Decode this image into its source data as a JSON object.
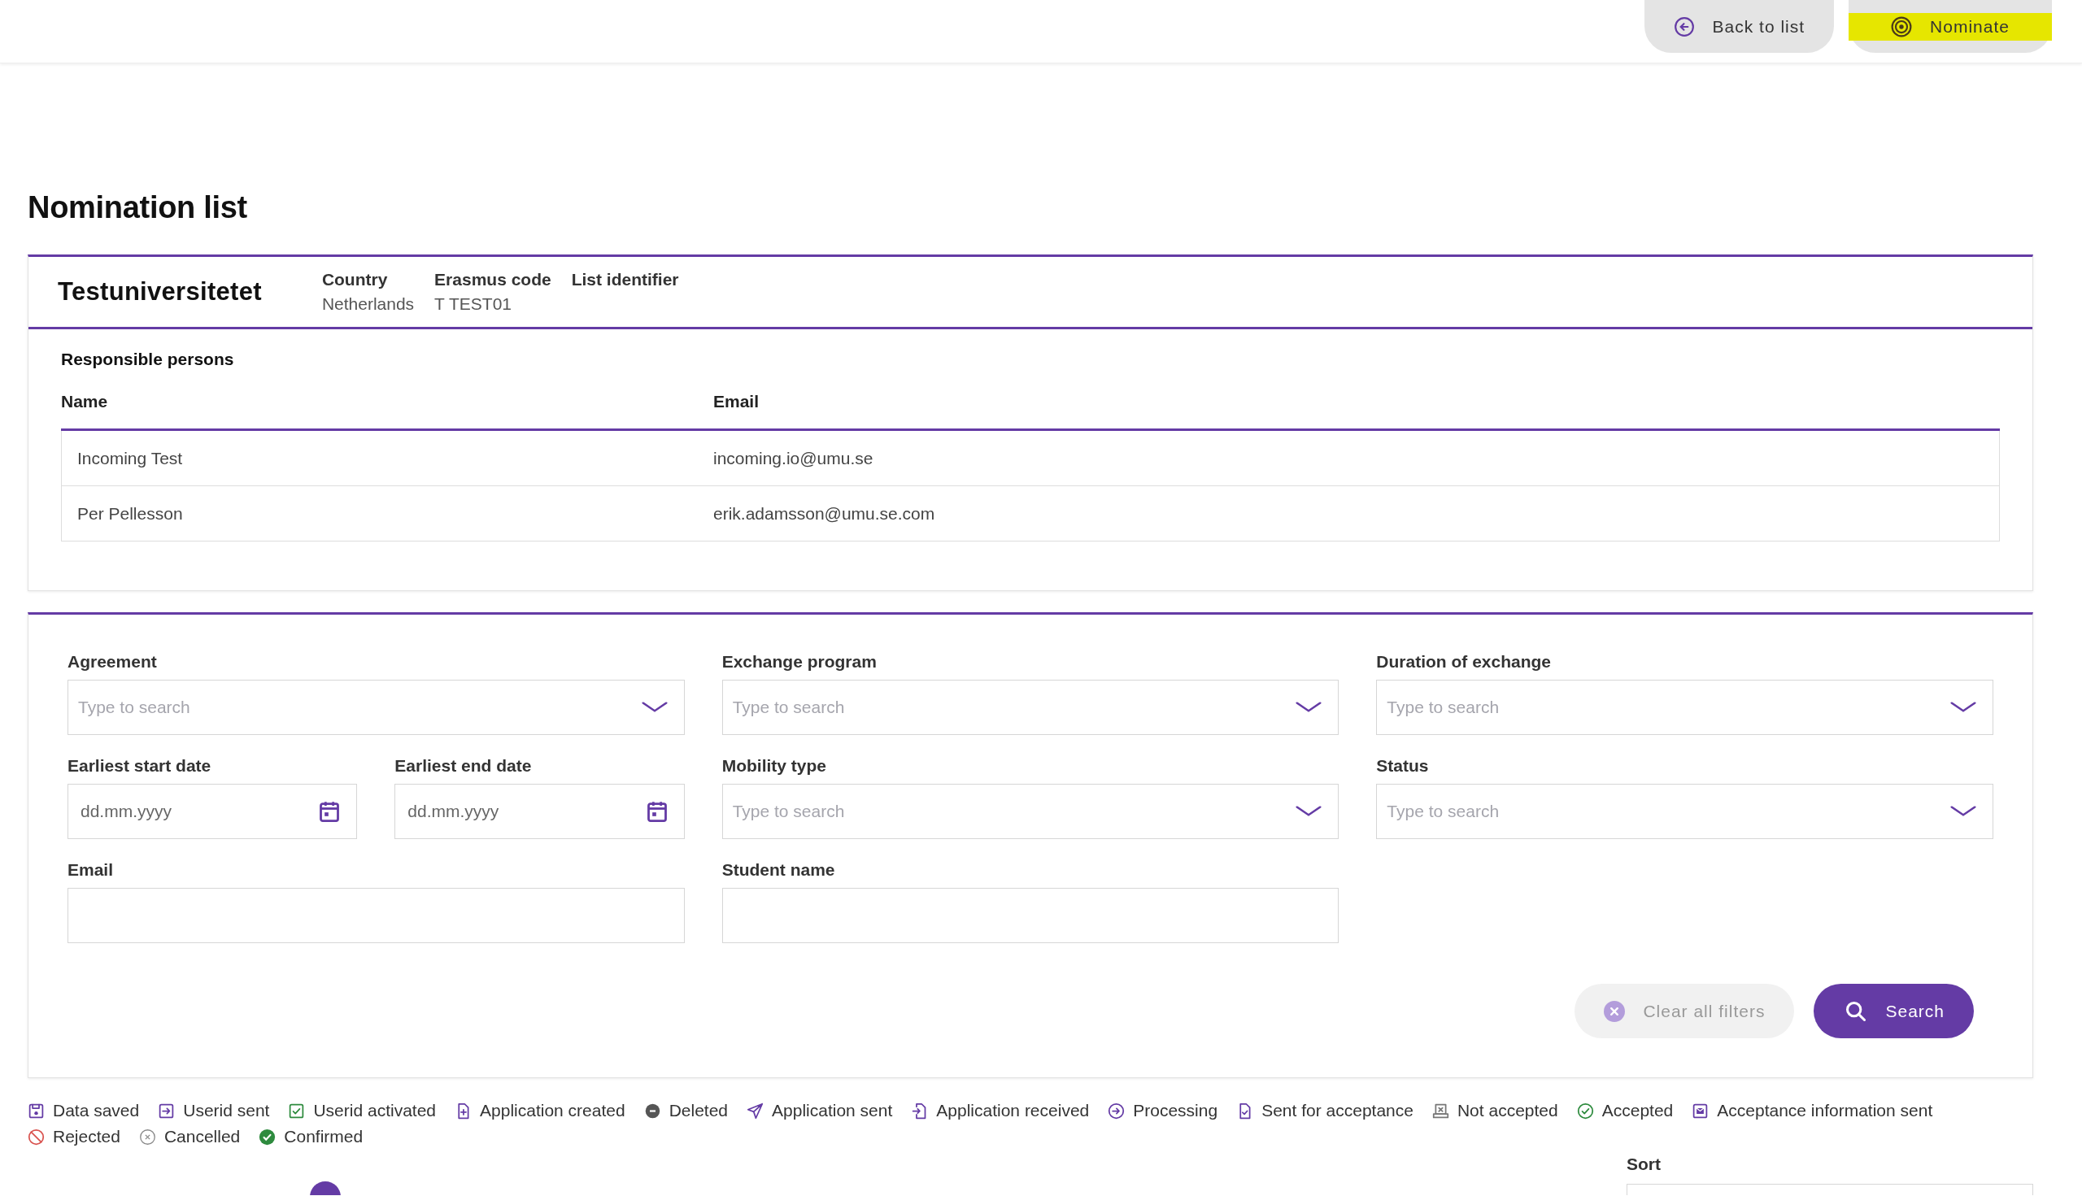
{
  "top_bar": {
    "buttons": [
      {
        "label": "Back to list",
        "kind": "back",
        "highlighted": false
      },
      {
        "label": "Nominate",
        "kind": "nominate",
        "highlighted": true
      }
    ]
  },
  "page_title": "Nomination list",
  "institution": {
    "name": "Testuniversitetet",
    "fields": [
      {
        "label": "Country",
        "value": "Netherlands"
      },
      {
        "label": "Erasmus code",
        "value": "T TEST01"
      },
      {
        "label": "List identifier"
      }
    ]
  },
  "responsible_persons": {
    "title": "Responsible persons",
    "columns": [
      "Name",
      "Email"
    ],
    "rows": [
      [
        "Incoming Test",
        "incoming.io@umu.se"
      ],
      [
        "Per Pellesson",
        "erik.adamsson@umu.se.com"
      ]
    ]
  },
  "filters": {
    "fields": [
      {
        "label": "Agreement",
        "kind": "select",
        "placeholder": "Type to search"
      },
      {
        "label": "Exchange program",
        "kind": "select",
        "placeholder": "Type to search"
      },
      {
        "label": "Duration of exchange",
        "kind": "select",
        "placeholder": "Type to search"
      },
      {
        "label": "Earliest start date",
        "kind": "date",
        "placeholder": "dd.mm.yyyy"
      },
      {
        "label": "Earliest end date",
        "kind": "date",
        "placeholder": "dd.mm.yyyy"
      },
      {
        "label": "Mobility type",
        "kind": "select",
        "placeholder": "Type to search"
      },
      {
        "label": "Status",
        "kind": "select",
        "placeholder": "Type to search"
      },
      {
        "label": "Email",
        "kind": "text"
      },
      {
        "label": "Student name",
        "kind": "text"
      }
    ],
    "clear_button": {
      "label": "Clear all filters",
      "disabled": true
    },
    "search_button": {
      "label": "Search",
      "disabled": false
    }
  },
  "legend": [
    {
      "label": "Data saved",
      "kind": "save"
    },
    {
      "label": "Userid sent",
      "kind": "arrowbox"
    },
    {
      "label": "Userid activated",
      "kind": "checkbox"
    },
    {
      "label": "Application created",
      "kind": "fileplus"
    },
    {
      "label": "Deleted",
      "kind": "minus"
    },
    {
      "label": "Application sent",
      "kind": "plane"
    },
    {
      "label": "Application received",
      "kind": "filein"
    },
    {
      "label": "Processing",
      "kind": "arrowcircle"
    },
    {
      "label": "Sent for acceptance",
      "kind": "filecheck"
    },
    {
      "label": "Not accepted",
      "kind": "tray"
    },
    {
      "label": "Accepted",
      "kind": "check"
    },
    {
      "label": "Acceptance information sent",
      "kind": "mail"
    },
    {
      "label": "Rejected",
      "kind": "ban"
    },
    {
      "label": "Cancelled",
      "kind": "cross"
    },
    {
      "label": "Confirmed",
      "kind": "checkfilled"
    }
  ],
  "sort": {
    "label": "Sort"
  }
}
